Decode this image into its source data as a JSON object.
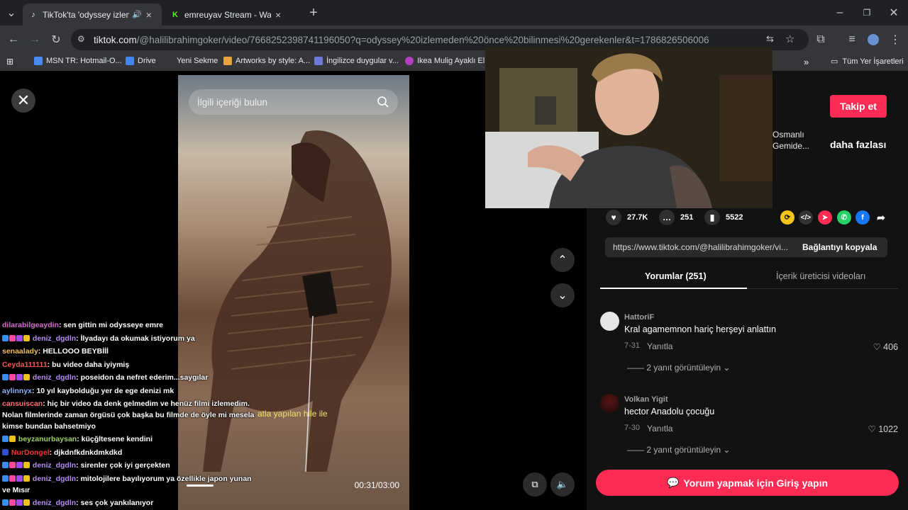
{
  "browser": {
    "tabs": [
      {
        "title": "TikTok'ta 'odyssey izlemeden",
        "active": true,
        "favicon": "tiktok-icon"
      },
      {
        "title": "emreuyav Stream - Watch Live",
        "active": false,
        "favicon": "kick-icon"
      }
    ],
    "new_tab": "+",
    "url_host": "tiktok.com",
    "url_path": "/@halilibrahimgoker/video/7668252398741196050?q=odyssey%20izlemeden%20önce%20bilinmesi%20gerekenler&t=1786826506006",
    "bookmarks": [
      {
        "label": "MSN TR: Hotmail-O...",
        "color": "#4a8af4"
      },
      {
        "label": "Drive",
        "color": "#4285f4"
      },
      {
        "label": "Yeni Sekme",
        "color": "#35363a"
      },
      {
        "label": "Artworks by style: A...",
        "color": "#e8a23a"
      },
      {
        "label": "İngilizce duygular v...",
        "color": "#6b7bd6"
      },
      {
        "label": "Ikea Mulig Ayaklı El...",
        "color": "#b040c0"
      }
    ],
    "bookmarks_more": "»",
    "all_bookmarks": "Tüm Yer İşaretleri"
  },
  "video": {
    "search_placeholder": "İlgili içeriği bulun",
    "caption": "atla yapılan hile ile",
    "time": "00:31/03:00",
    "progress": 0.17
  },
  "chat": [
    {
      "user": "dilarabilgeaydin",
      "color": "#d06fd0",
      "badges": [],
      "text": ": sen gittin mi odysseye emre"
    },
    {
      "user": "deniz_dgdln",
      "color": "#b48cf0",
      "badges": [
        "#3a8ef0",
        "#ff4aa0",
        "#a04af0",
        "#f0c020"
      ],
      "text": ": İlyadayı da okumak istiyorum ya"
    },
    {
      "user": "senaalady",
      "color": "#f0c060",
      "badges": [],
      "text": ": HELLOOO BEYBİİİ"
    },
    {
      "user": "Ceyda111111",
      "color": "#ff5050",
      "badges": [],
      "text": ": bu video daha iyiymiş"
    },
    {
      "user": "deniz_dgdln",
      "color": "#b48cf0",
      "badges": [
        "#3a8ef0",
        "#ff4aa0",
        "#a04af0",
        "#f0c020"
      ],
      "text": ": poseidon da nefret ederim...saygılar"
    },
    {
      "user": "aylinnyx",
      "color": "#8fb0ff",
      "badges": [],
      "text": ": 10 yıl kaybolduğu yer de ege denizi mk"
    },
    {
      "user": "cansuiscan",
      "color": "#ff7070",
      "badges": [],
      "text": ": hiç bir video da denk gelmedim ve henüz filmi izlemedim. Nolan filmlerinde zaman örgüsü çok başka bu filmde de öyle mi mesela kimse bundan bahsetmiyo",
      "wrap": true
    },
    {
      "user": "beyzanurbaysan",
      "color": "#9cd060",
      "badges": [
        "#3a8ef0",
        "#f0c020"
      ],
      "text": ": küçğltesene kendini"
    },
    {
      "user": "NurDongel",
      "color": "#ff3030",
      "badges": [
        "#3050d0"
      ],
      "text": ": djkdnfkdnkdmkdkd"
    },
    {
      "user": "deniz_dgdln",
      "color": "#b48cf0",
      "badges": [
        "#3a8ef0",
        "#ff4aa0",
        "#a04af0",
        "#f0c020"
      ],
      "text": ": sirenler çok iyi gerçekten"
    },
    {
      "user": "deniz_dgdln",
      "color": "#b48cf0",
      "badges": [
        "#3a8ef0",
        "#ff4aa0",
        "#a04af0",
        "#f0c020"
      ],
      "text": ": mitolojilere bayılıyorum ya özellikle japon yunan ve Mısır",
      "wrap": true
    },
    {
      "user": "deniz_dgdln",
      "color": "#b48cf0",
      "badges": [
        "#3a8ef0",
        "#ff4aa0",
        "#a04af0",
        "#f0c020"
      ],
      "text": ": ses çok yankılanıyor"
    }
  ],
  "panel": {
    "follow": "Takip et",
    "desc_line1": "Osmanlı",
    "desc_line2": "Gemide...",
    "more": "daha fazlası",
    "likes": "27.7K",
    "comments": "251",
    "saves": "5522",
    "link": "https://www.tiktok.com/@halilibrahimgoker/vi...",
    "copy_link": "Bağlantıyı kopyala",
    "tab_comments": "Yorumlar (251)",
    "tab_creator": "İçerik üreticisi videoları",
    "comments_list": [
      {
        "user": "HattoriF",
        "text": "Kral agamemnon hariç herşeyi anlattın",
        "date": "7-31",
        "reply": "Yanıtla",
        "likes": "406",
        "view": "2 yanıt görüntüleyin"
      },
      {
        "user": "Volkan Yigit",
        "text": "hector Anadolu çocuğu",
        "date": "7-30",
        "reply": "Yanıtla",
        "likes": "1022",
        "view": "2 yanıt görüntüleyin"
      }
    ],
    "login": "Yorum yapmak için Giriş yapın"
  }
}
